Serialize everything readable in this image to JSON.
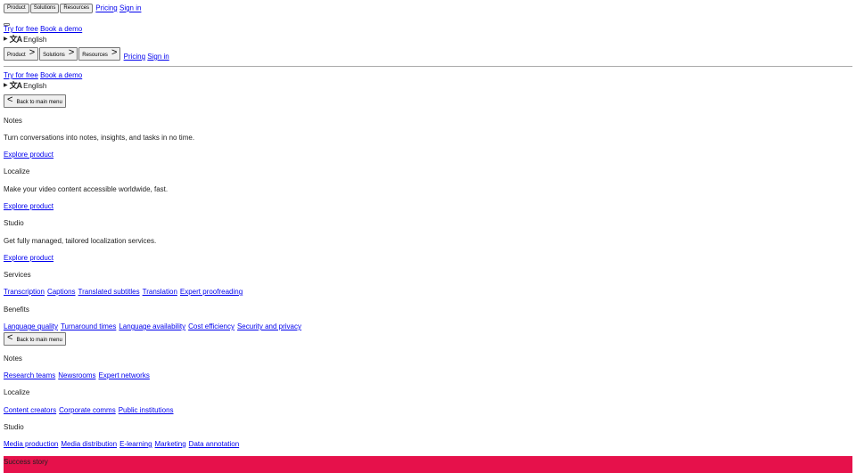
{
  "nav_top": {
    "buttons": [
      "Product",
      "Solutions",
      "Resources"
    ],
    "links": [
      "Pricing",
      "Sign in"
    ]
  },
  "cta": {
    "try_free": "Try for free",
    "book_demo": "Book a demo"
  },
  "language": {
    "label": "English",
    "icon": "translate-icon"
  },
  "nav_main": {
    "buttons": [
      "Product",
      "Solutions",
      "Resources"
    ],
    "links": [
      "Pricing",
      "Sign in"
    ]
  },
  "back_label": "Back to main menu",
  "product_menu": {
    "notes": {
      "title": "Notes",
      "desc": "Turn conversations into notes, insights, and tasks in no time.",
      "link": "Explore product"
    },
    "localize": {
      "title": "Localize",
      "desc": "Make your video content accessible worldwide, fast.",
      "link": "Explore product"
    },
    "studio": {
      "title": "Studio",
      "desc": "Get fully managed, tailored localization services.",
      "link": "Explore product"
    },
    "services": {
      "title": "Services",
      "links": [
        "Transcription",
        "Captions",
        "Translated subtitles",
        "Translation",
        "Expert proofreading"
      ]
    },
    "benefits": {
      "title": "Benefits",
      "links": [
        "Language quality",
        "Turnaround times",
        "Language availability",
        "Cost efficiency",
        "Security and privacy"
      ]
    }
  },
  "solutions_menu": {
    "notes": {
      "title": "Notes",
      "links": [
        "Research teams",
        "Newsrooms",
        "Expert networks"
      ]
    },
    "localize": {
      "title": "Localize",
      "links": [
        "Content creators",
        "Corporate comms",
        "Public institutions"
      ]
    },
    "studio": {
      "title": "Studio",
      "links": [
        "Media production",
        "Media distribution",
        "E-learning",
        "Marketing",
        "Data annotation"
      ]
    }
  },
  "banner": {
    "label": "Success story",
    "color": "#e6114b"
  }
}
